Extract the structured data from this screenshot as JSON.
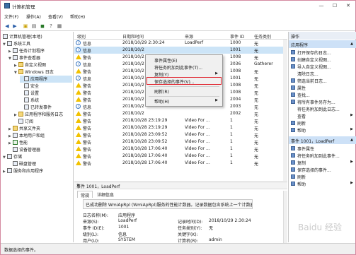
{
  "window": {
    "title": "计算机管理",
    "controls": [
      "—",
      "☐",
      "✕"
    ]
  },
  "menu": [
    "文件(F)",
    "操作(A)",
    "查看(V)",
    "帮助(H)"
  ],
  "tree": [
    {
      "label": "计算机管理(本地)",
      "icon": "computer-icon"
    },
    {
      "label": "系统工具",
      "icon": "tools-icon"
    },
    {
      "label": "任务计划程序",
      "icon": "calendar-icon"
    },
    {
      "label": "事件查看器",
      "icon": "event-viewer-icon"
    },
    {
      "label": "自定义视图",
      "icon": "folder-icon"
    },
    {
      "label": "Windows 日志",
      "icon": "folder-icon"
    },
    {
      "label": "应用程序",
      "icon": "log-icon"
    },
    {
      "label": "安全",
      "icon": "log-icon"
    },
    {
      "label": "设置",
      "icon": "log-icon"
    },
    {
      "label": "系统",
      "icon": "log-icon"
    },
    {
      "label": "已转发事件",
      "icon": "log-icon"
    },
    {
      "label": "应用程序和服务日志",
      "icon": "folder-icon"
    },
    {
      "label": "订阅",
      "icon": "subscription-icon"
    },
    {
      "label": "共享文件夹",
      "icon": "shared-folder-icon"
    },
    {
      "label": "本地用户和组",
      "icon": "users-icon"
    },
    {
      "label": "性能",
      "icon": "performance-icon"
    },
    {
      "label": "设备管理器",
      "icon": "device-icon"
    },
    {
      "label": "存储",
      "icon": "storage-icon"
    },
    {
      "label": "磁盘管理",
      "icon": "disk-icon"
    },
    {
      "label": "服务和应用程序",
      "icon": "services-icon"
    }
  ],
  "events": {
    "columns": [
      "级别",
      "日期和时间",
      "来源",
      "事件 ID",
      "任务类别"
    ],
    "rows": [
      {
        "level": "信息",
        "datetime": "2018/10/29 2:30:24",
        "source": "LoadPerf",
        "id": "1000",
        "category": "无"
      },
      {
        "level": "信息",
        "datetime": "2018/10/2",
        "source": "",
        "id": "1001",
        "category": "无"
      },
      {
        "level": "警告",
        "datetime": "2018/10/2",
        "source": "",
        "id": "1008",
        "category": "无"
      },
      {
        "level": "信息",
        "datetime": "2018/10/2",
        "source": "",
        "id": "3036",
        "category": "Gatherer"
      },
      {
        "level": "警告",
        "datetime": "2018/10/2",
        "source": "",
        "id": "1008",
        "category": "无"
      },
      {
        "level": "信息",
        "datetime": "2018/10/2",
        "source": "",
        "id": "1001",
        "category": "无"
      },
      {
        "level": "警告",
        "datetime": "2018/10/2",
        "source": "",
        "id": "1008",
        "category": "无"
      },
      {
        "level": "警告",
        "datetime": "2018/10/2",
        "source": "",
        "id": "1008",
        "category": "无"
      },
      {
        "level": "警告",
        "datetime": "2018/10/2",
        "source": "",
        "id": "2004",
        "category": "无"
      },
      {
        "level": "信息",
        "datetime": "2018/10/2",
        "source": "",
        "id": "2003",
        "category": "无"
      },
      {
        "level": "警告",
        "datetime": "2018/10/2",
        "source": "",
        "id": "2002",
        "category": "无"
      },
      {
        "level": "警告",
        "datetime": "2018/10/28 23:19:29",
        "source": "Video For ...",
        "id": "1",
        "category": "无"
      },
      {
        "level": "警告",
        "datetime": "2018/10/28 23:19:29",
        "source": "Video For ...",
        "id": "1",
        "category": "无"
      },
      {
        "level": "警告",
        "datetime": "2018/10/28 23:09:52",
        "source": "Video For ...",
        "id": "1",
        "category": "无"
      },
      {
        "level": "警告",
        "datetime": "2018/10/28 23:09:52",
        "source": "Video For ...",
        "id": "1",
        "category": "无"
      },
      {
        "level": "警告",
        "datetime": "2018/10/28 17:06:40",
        "source": "Video For ...",
        "id": "1",
        "category": "无"
      },
      {
        "level": "警告",
        "datetime": "2018/10/28 17:06:40",
        "source": "Video For ...",
        "id": "1",
        "category": "无"
      },
      {
        "level": "警告",
        "datetime": "2018/10/28 17:06:40",
        "source": "Video For ...",
        "id": "1",
        "category": "无"
      }
    ]
  },
  "context_menu": {
    "items": [
      {
        "label": "事件属性(E)",
        "submenu": false
      },
      {
        "label": "将任务附加到此事件(T)...",
        "submenu": false
      },
      {
        "label": "复制(Y)",
        "submenu": true
      },
      {
        "label": "保存选择的事件(V)...",
        "submenu": false
      },
      {
        "label": "刷新(R)",
        "submenu": false
      },
      {
        "label": "帮助(H)",
        "submenu": true
      }
    ]
  },
  "detail": {
    "title": "事件 1001，LoadPerf",
    "close": "✕",
    "tabs": [
      "常规",
      "详细信息"
    ],
    "message": "已成功删除 WmiApRpl (WmiApRpl)服务的性能计数器。记录数据包含系统上一个计数器和上",
    "fields": [
      {
        "label": "日志名称(M):",
        "value": "应用程序"
      },
      {
        "label": "来源(S):",
        "value": "LoadPerf"
      },
      {
        "label": "事件 ID(E):",
        "value": "1001"
      },
      {
        "label": "级别(L):",
        "value": "信息"
      },
      {
        "label": "用户(U):",
        "value": "SYSTEM"
      }
    ],
    "fields_right": [
      {
        "label": "记录时间(D):",
        "value": "2018/10/29 2:30:24"
      },
      {
        "label": "任务类别(Y):",
        "value": "无"
      },
      {
        "label": "关键字(K):",
        "value": ""
      },
      {
        "label": "计算机(R):",
        "value": "admin"
      }
    ]
  },
  "actions": {
    "header": "操作",
    "section1": "应用程序",
    "items1": [
      {
        "label": "打开保存的日志...",
        "icon": "open-folder-icon",
        "submenu": false
      },
      {
        "label": "创建自定义视图...",
        "icon": "create-view-icon",
        "submenu": false
      },
      {
        "label": "导入自定义视图...",
        "icon": "import-icon",
        "submenu": false
      },
      {
        "label": "清除日志...",
        "icon": "",
        "submenu": false
      },
      {
        "label": "筛选当前日志...",
        "icon": "filter-icon",
        "submenu": false
      },
      {
        "label": "属性",
        "icon": "properties-icon",
        "submenu": false
      },
      {
        "label": "查找...",
        "icon": "find-icon",
        "submenu": false
      },
      {
        "label": "将所有事件另存为...",
        "icon": "save-icon",
        "submenu": false
      },
      {
        "label": "将任务附加到此日志...",
        "icon": "",
        "submenu": false
      },
      {
        "label": "查看",
        "icon": "",
        "submenu": true
      },
      {
        "label": "刷新",
        "icon": "refresh-icon",
        "submenu": false
      },
      {
        "label": "帮助",
        "icon": "help-icon",
        "submenu": true
      }
    ],
    "section2": "事件 1001，LoadPerf",
    "items2": [
      {
        "label": "事件属性",
        "icon": "properties-icon",
        "submenu": false
      },
      {
        "label": "将任务附加到此事件...",
        "icon": "task-icon",
        "submenu": false
      },
      {
        "label": "复制",
        "icon": "copy-icon",
        "submenu": true
      },
      {
        "label": "保存选择的事件...",
        "icon": "save-icon",
        "submenu": false
      },
      {
        "label": "刷新",
        "icon": "refresh-icon",
        "submenu": false
      },
      {
        "label": "帮助",
        "icon": "help-icon",
        "submenu": true
      }
    ]
  },
  "status": "数据选择的事件。",
  "watermark": "Baidu 经验"
}
